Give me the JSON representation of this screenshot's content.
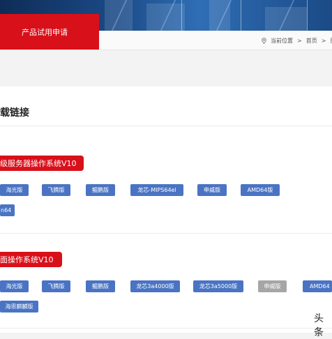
{
  "tab": {
    "label": "产品试用申请"
  },
  "breadcrumb": {
    "location_label": "当前位置",
    "sep": ">",
    "home": "首页",
    "current": "服务"
  },
  "page": {
    "title": "载链接"
  },
  "sections": [
    {
      "title": "级服务器操作系统V10",
      "buttons": [
        "海光版",
        "飞腾版",
        "鲲鹏版",
        "龙芯-MIPS64el",
        "申威版",
        "AMD64版",
        "n64"
      ]
    },
    {
      "title": "面操作系统V10",
      "buttons": [
        "海光版",
        "飞腾版",
        "鲲鹏版",
        "龙芯3a4000版",
        "龙芯3a5000版",
        "申威版",
        "AMD64",
        "海思麒麟版"
      ]
    }
  ],
  "watermark": {
    "text": "头条"
  },
  "colors": {
    "accent_red": "#d8101a",
    "button_blue": "#4a74c3",
    "button_disabled": "#a6a6a6"
  }
}
